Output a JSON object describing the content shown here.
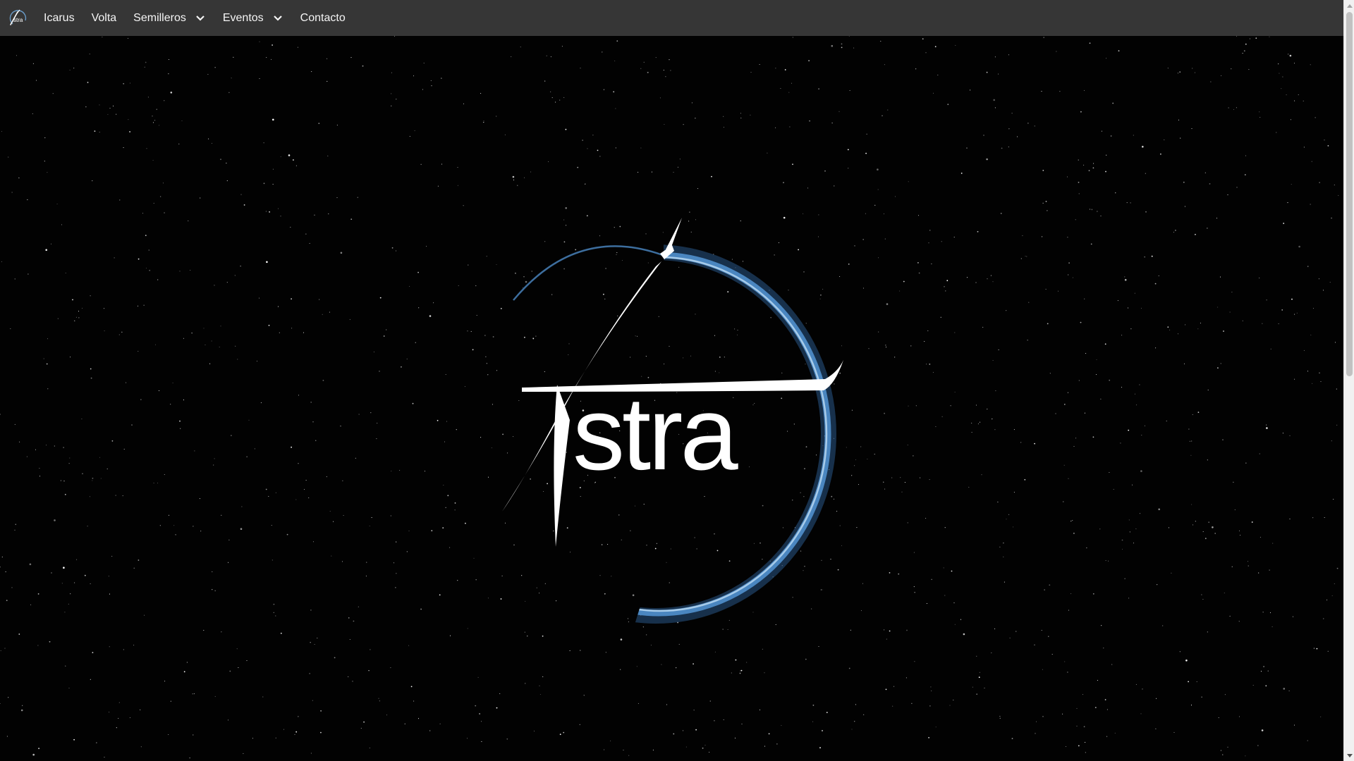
{
  "navbar": {
    "logo_icon": "astra-logo-icon",
    "items": [
      {
        "label": "Icarus",
        "has_dropdown": false
      },
      {
        "label": "Volta",
        "has_dropdown": false
      },
      {
        "label": "Semilleros",
        "has_dropdown": true
      },
      {
        "label": "Eventos",
        "has_dropdown": true
      },
      {
        "label": "Contacto",
        "has_dropdown": false
      }
    ]
  },
  "hero": {
    "logo_text": "Astra",
    "background": "starfield"
  },
  "colors": {
    "navbar_bg": "#363636",
    "nav_text": "#f5f5f5",
    "hero_bg": "#020202",
    "logo_white": "#ffffff",
    "atmosphere_blue": "#3a6fa8"
  }
}
